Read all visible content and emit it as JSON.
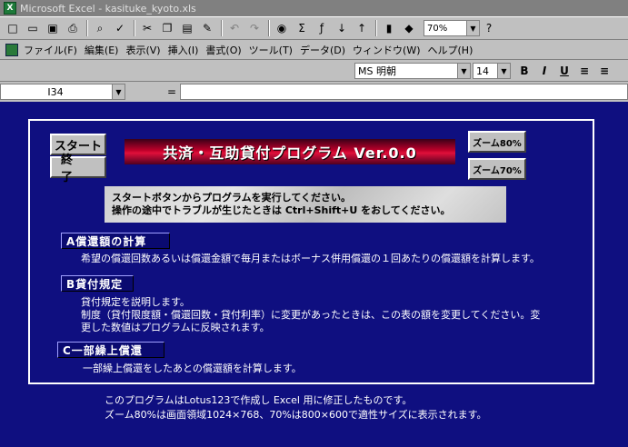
{
  "window": {
    "title": "Microsoft Excel - kasituke_kyoto.xls"
  },
  "toolbar": {
    "zoom": "70%"
  },
  "menu": {
    "items": [
      "ファイル(F)",
      "編集(E)",
      "表示(V)",
      "挿入(I)",
      "書式(O)",
      "ツール(T)",
      "データ(D)",
      "ウィンドウ(W)",
      "ヘルプ(H)"
    ]
  },
  "format": {
    "font": "MS 明朝",
    "size": "14",
    "bold": "B",
    "italic": "I",
    "underline": "U"
  },
  "formula": {
    "cell": "I34",
    "eq": "="
  },
  "sheet": {
    "start_button": "スタート",
    "end_button": "終 了",
    "zoom80_button": "ズーム80%",
    "zoom70_button": "ズーム70%",
    "program_title": "共済・互助貸付プログラム Ver.0.0",
    "notice": [
      "スタートボタンからプログラムを実行してください。",
      "操作の途中でトラブルが生じたときは Ctrl+Shift+U をおしてください。"
    ],
    "sections": [
      {
        "label": "A償還額の計算",
        "desc": [
          "希望の償還回数あるいは償還金額で毎月またはボーナス併用償還の１回あたりの償還額を計算します。"
        ]
      },
      {
        "label": "B貸付規定",
        "desc": [
          "貸付規定を説明します。",
          "制度（貸付限度額・償還回数・貸付利率）に変更があったときは、この表の額を変更してください。変",
          "更した数値はプログラムに反映されます。"
        ]
      },
      {
        "label": "C一部繰上償還",
        "desc": [
          "一部繰上償還をしたあとの償還額を計算します。"
        ]
      }
    ],
    "footer": [
      "このプログラムはLotus123で作成し Excel 用に修正したものです。",
      "ズーム80%は画面領域1024×768、70%は800×600で適性サイズに表示されます。"
    ]
  }
}
